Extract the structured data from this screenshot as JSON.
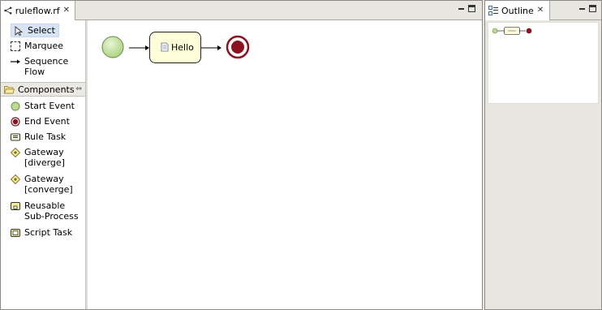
{
  "editor": {
    "tab_title": "ruleflow.rf",
    "palette": {
      "tools": [
        {
          "label": "Select"
        },
        {
          "label": "Marquee"
        },
        {
          "label": "Sequence Flow"
        }
      ],
      "drawer_label": "Components",
      "components": [
        {
          "label": "Start Event"
        },
        {
          "label": "End Event"
        },
        {
          "label": "Rule Task"
        },
        {
          "label": "Gateway [diverge]"
        },
        {
          "label": "Gateway [converge]"
        },
        {
          "label": "Reusable Sub-Process"
        },
        {
          "label": "Script Task"
        }
      ]
    },
    "canvas": {
      "task_label": "Hello"
    }
  },
  "outline": {
    "tab_title": "Outline"
  },
  "colors": {
    "start_event": "#b8dd90",
    "end_event": "#8c1220",
    "task_fill": "#fdfdd9",
    "selection": "#d6e4f6"
  }
}
